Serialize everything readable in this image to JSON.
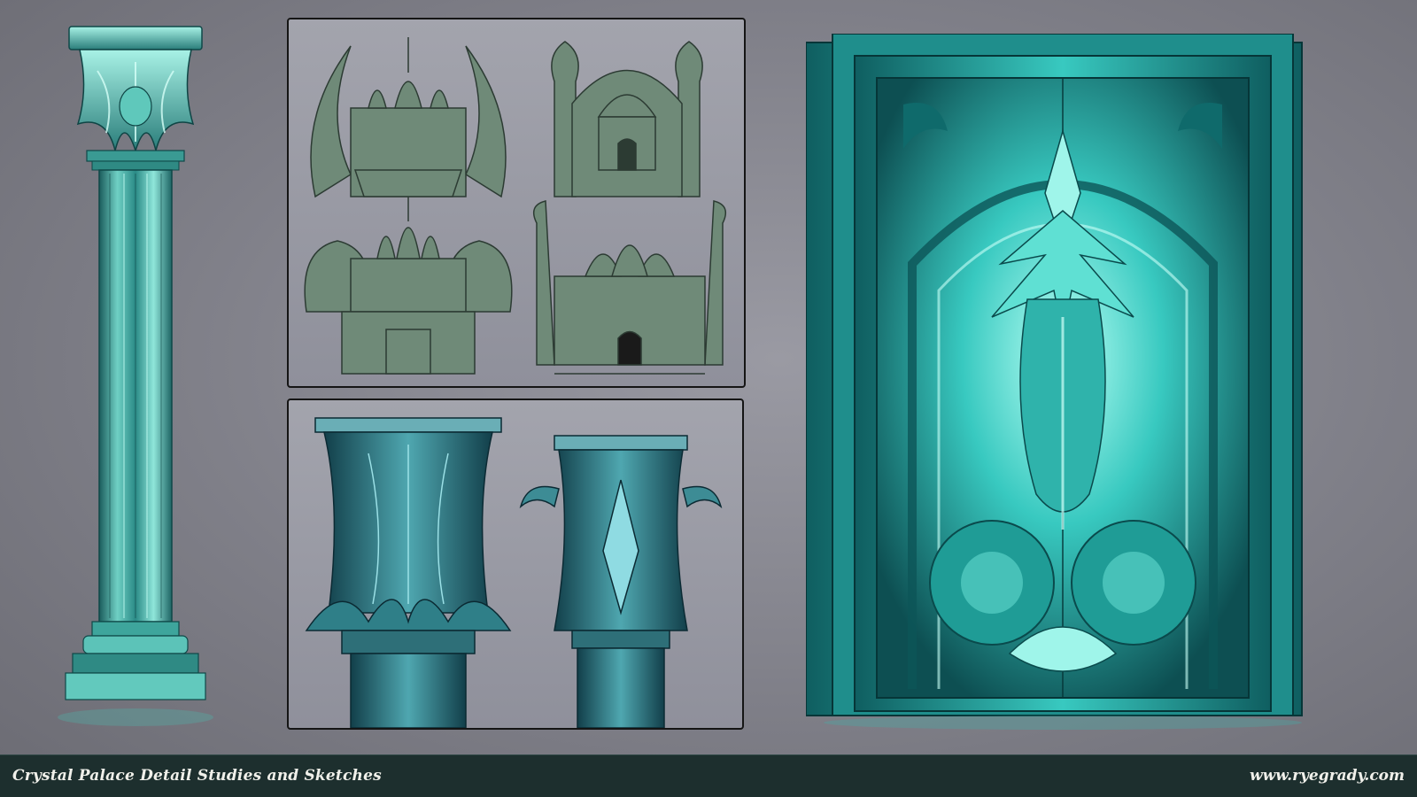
{
  "footer": {
    "title": "Crystal Palace Detail Studies and Sketches",
    "website": "www.ryegrady.com"
  },
  "palette": {
    "crystal_teal": "#38c9c0",
    "crystal_dark": "#0f5e60",
    "crystal_highlight": "#b8fff4",
    "sketch_fill": "#6f8a78",
    "sketch_line": "#2c3b33",
    "capital_blue": "#2f6f7a",
    "footer_bg": "#1d2f2e",
    "background": "#8a8a93"
  },
  "artworks": [
    {
      "id": "crystal-column",
      "subject": "crystal column"
    },
    {
      "id": "palace-sketches",
      "subject": "palace sketch thumbnails",
      "count": 4
    },
    {
      "id": "capital-studies",
      "subject": "column capital studies",
      "count": 2
    },
    {
      "id": "dragon-door",
      "subject": "crystal dragon door"
    }
  ]
}
